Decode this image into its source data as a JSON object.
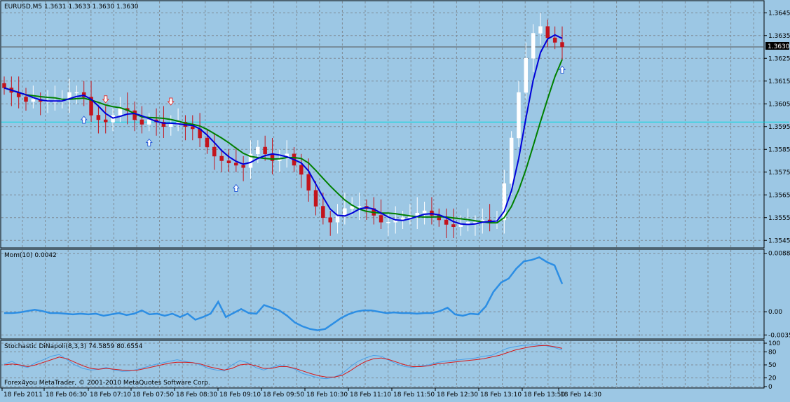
{
  "chart_data": [
    {
      "type": "candlestick",
      "title": "EURUSD,M5  1.3631 1.3633 1.3630 1.3630",
      "symbol": "EURUSD,M5",
      "ylim": [
        1.3542,
        1.365
      ],
      "ticks": [
        "1.3645",
        "1.3635",
        "1.3625",
        "1.3615",
        "1.3605",
        "1.3595",
        "1.3585",
        "1.3575",
        "1.3565",
        "1.3555",
        "1.3545"
      ],
      "tick_values": [
        1.3645,
        1.3635,
        1.3625,
        1.3615,
        1.3605,
        1.3595,
        1.3585,
        1.3575,
        1.3565,
        1.3555,
        1.3545
      ],
      "current_price": "1.3630",
      "current_price_value": 1.363,
      "level_line_value": 1.3597,
      "close_approx": [
        1.3612,
        1.361,
        1.3608,
        1.3606,
        1.3607,
        1.3606,
        1.3606,
        1.3606,
        1.3607,
        1.361,
        1.361,
        1.3608,
        1.36,
        1.3598,
        1.3597,
        1.36,
        1.3603,
        1.3602,
        1.3598,
        1.3596,
        1.3598,
        1.3597,
        1.3595,
        1.3596,
        1.3597,
        1.3595,
        1.3594,
        1.359,
        1.3586,
        1.3582,
        1.358,
        1.3579,
        1.3578,
        1.3577,
        1.3583,
        1.3586,
        1.3583,
        1.358,
        1.3581,
        1.3583,
        1.3578,
        1.3574,
        1.3567,
        1.356,
        1.3555,
        1.3553,
        1.3556,
        1.3559,
        1.356,
        1.356,
        1.3559,
        1.3556,
        1.3553,
        1.3553,
        1.3554,
        1.3555,
        1.3556,
        1.3557,
        1.3558,
        1.3556,
        1.3554,
        1.3552,
        1.3551,
        1.3552,
        1.3553,
        1.3553,
        1.3554,
        1.3553,
        1.3554,
        1.357,
        1.359,
        1.361,
        1.3625,
        1.3636,
        1.3639,
        1.3634,
        1.3632,
        1.363
      ]
    },
    {
      "type": "line",
      "title": "Mom(10) 0.0042",
      "ticks": [
        "0.0088",
        "0.00",
        "-0.0035"
      ],
      "tick_values": [
        0.0088,
        0.0,
        -0.0035
      ],
      "ylim": [
        -0.004,
        0.0093
      ],
      "values": [
        -0.0002,
        -0.0002,
        -0.0001,
        0.0001,
        0.0003,
        0.0001,
        -0.0002,
        -0.0002,
        -0.0003,
        -0.0004,
        -0.0003,
        -0.0004,
        -0.0003,
        -0.0006,
        -0.0004,
        -0.0002,
        -0.0005,
        -0.0003,
        0.0002,
        -0.0004,
        -0.0003,
        -0.0006,
        -0.0003,
        -0.0008,
        -0.0003,
        -0.0012,
        -0.0008,
        -0.0003,
        0.0015,
        -0.0008,
        -0.0002,
        0.0004,
        -0.0002,
        -0.0003,
        0.001,
        0.0006,
        0.0002,
        -0.0006,
        -0.0016,
        -0.0022,
        -0.0026,
        -0.0028,
        -0.0026,
        -0.0018,
        -0.001,
        -0.0004,
        0.0,
        0.0002,
        0.0002,
        0.0,
        -0.0002,
        -0.0001,
        -0.0002,
        -0.0002,
        -0.0003,
        -0.0002,
        -0.0002,
        0.0001,
        0.0006,
        -0.0004,
        -0.0006,
        -0.0003,
        -0.0004,
        0.0008,
        0.003,
        0.0044,
        0.005,
        0.0065,
        0.0076,
        0.0078,
        0.0082,
        0.0075,
        0.007,
        0.0042
      ]
    },
    {
      "type": "line",
      "title": "Stochastic DiNapoli(8,3,3) 74.5859 80.6554",
      "ticks": [
        "100",
        "80",
        "50",
        "20",
        "0"
      ],
      "tick_values": [
        100,
        80,
        50,
        20,
        0
      ],
      "ylim": [
        0,
        100
      ],
      "series": [
        {
          "values": [
            52,
            58,
            48,
            44,
            55,
            62,
            70,
            74,
            62,
            50,
            42,
            38,
            40,
            44,
            38,
            35,
            36,
            40,
            45,
            50,
            54,
            58,
            62,
            58,
            55,
            50,
            42,
            38,
            36,
            50,
            60,
            55,
            44,
            38,
            44,
            50,
            46,
            40,
            30,
            25,
            20,
            18,
            22,
            30,
            45,
            58,
            66,
            72,
            70,
            60,
            52,
            46,
            44,
            48,
            50,
            55,
            58,
            60,
            62,
            64,
            66,
            70,
            72,
            80,
            88,
            92,
            95,
            96,
            96,
            94,
            90,
            84
          ]
        },
        {
          "values": [
            50,
            52,
            50,
            46,
            50,
            56,
            62,
            68,
            64,
            56,
            48,
            42,
            40,
            42,
            40,
            38,
            37,
            38,
            42,
            46,
            50,
            54,
            56,
            56,
            55,
            52,
            46,
            42,
            38,
            42,
            50,
            52,
            48,
            42,
            42,
            46,
            46,
            42,
            36,
            30,
            25,
            22,
            22,
            26,
            36,
            48,
            58,
            64,
            66,
            62,
            56,
            50,
            46,
            46,
            48,
            52,
            54,
            56,
            58,
            60,
            62,
            64,
            68,
            72,
            78,
            84,
            88,
            92,
            94,
            95,
            92,
            88
          ]
        }
      ]
    }
  ],
  "colors": {
    "background": "#9cc7e4",
    "grid": "#7f8c97",
    "bull": "#ffffff",
    "bear": "#c3141c",
    "ma_fast": "#0000d8",
    "ma_slow": "#008000",
    "momentum": "#2c8ee4",
    "stoch_main": "#d81818",
    "stoch_signal": "#4aa0e8",
    "level_line": "#00d8e0",
    "arrow_up": "#2c5fd8",
    "arrow_down": "#e03030"
  },
  "xlabels": [
    "18 Feb 2011",
    "18 Feb 06:30",
    "18 Feb 07:10",
    "18 Feb 07:50",
    "18 Feb 08:30",
    "18 Feb 09:10",
    "18 Feb 09:50",
    "18 Feb 10:30",
    "18 Feb 11:10",
    "18 Feb 11:50",
    "18 Feb 12:30",
    "18 Feb 13:10",
    "18 Feb 13:50",
    "18 Feb 14:30"
  ],
  "copyright": "Forex4you MetaTrader, © 2001-2010 MetaQuotes Software Corp."
}
